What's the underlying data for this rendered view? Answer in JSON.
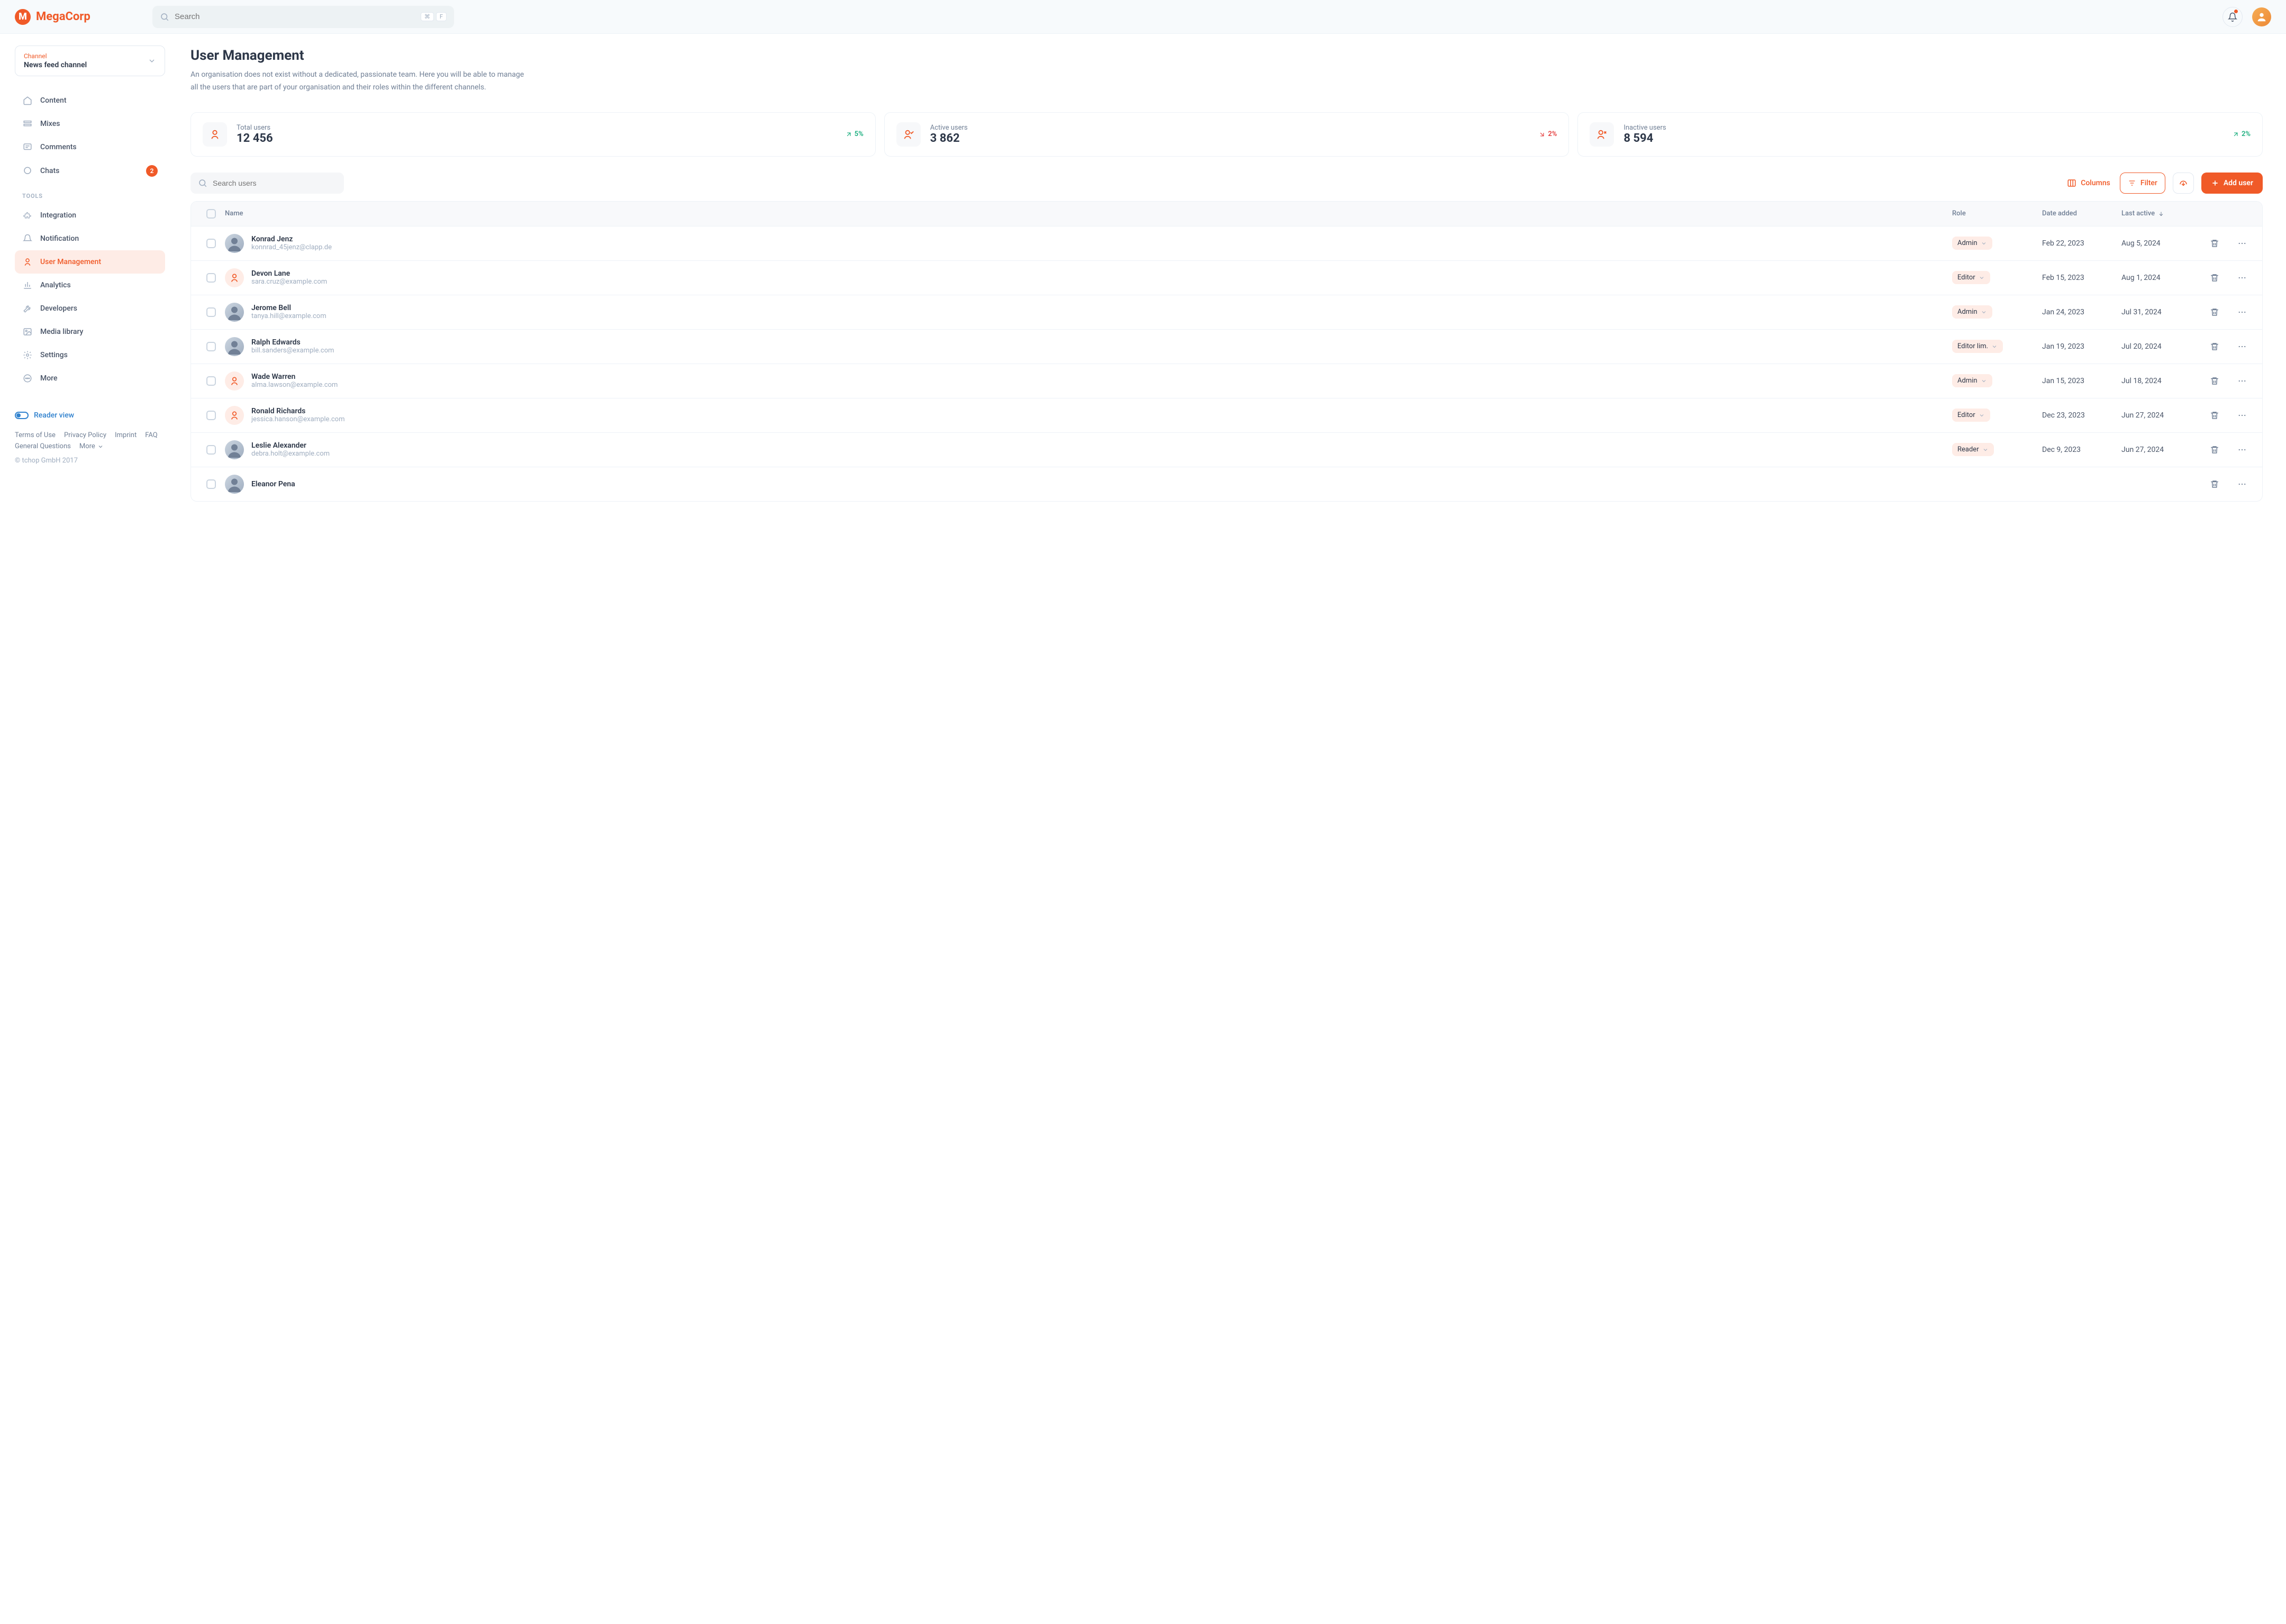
{
  "brand": {
    "name": "MegaCorp",
    "mark": "M"
  },
  "search": {
    "placeholder": "Search",
    "kbd1": "⌘",
    "kbd2": "F"
  },
  "channel": {
    "label": "Channel",
    "value": "News feed channel"
  },
  "nav": {
    "content": "Content",
    "mixes": "Mixes",
    "comments": "Comments",
    "chats": "Chats",
    "chats_badge": "2",
    "tools_label": "TOOLS",
    "integration": "Integration",
    "notification": "Notification",
    "user_management": "User Management",
    "analytics": "Analytics",
    "developers": "Developers",
    "media_library": "Media library",
    "settings": "Settings",
    "more": "More"
  },
  "reader_view": "Reader view",
  "footer": {
    "terms": "Terms of Use",
    "privacy": "Privacy Policy",
    "imprint": "Imprint",
    "faq": "FAQ",
    "general": "General Questions",
    "more": "More",
    "copyright": "© tchop GmbH 2017"
  },
  "page": {
    "title": "User Management",
    "description": "An organisation does not exist without a dedicated, passionate team. Here you will be able to manage all the users that are part of your organisation and their roles within the different channels."
  },
  "stats": [
    {
      "label": "Total users",
      "value": "12 456",
      "trend": "5%",
      "trend_dir": "up"
    },
    {
      "label": "Active users",
      "value": "3 862",
      "trend": "2%",
      "trend_dir": "down"
    },
    {
      "label": "Inactive users",
      "value": "8 594",
      "trend": "2%",
      "trend_dir": "up"
    }
  ],
  "toolbar": {
    "search_placeholder": "Search users",
    "columns": "Columns",
    "filter": "Filter",
    "add_user": "Add user"
  },
  "table": {
    "headers": {
      "name": "Name",
      "role": "Role",
      "date_added": "Date added",
      "last_active": "Last active"
    },
    "rows": [
      {
        "name": "Konrad Jenz",
        "email": "konnrad_45jenz@clapp.de",
        "role": "Admin",
        "date_added": "Feb 22, 2023",
        "last_active": "Aug 5, 2024",
        "avatar": "photo"
      },
      {
        "name": "Devon Lane",
        "email": "sara.cruz@example.com",
        "role": "Editor",
        "date_added": "Feb 15, 2023",
        "last_active": "Aug 1, 2024",
        "avatar": "icon"
      },
      {
        "name": "Jerome Bell",
        "email": "tanya.hill@example.com",
        "role": "Admin",
        "date_added": "Jan 24, 2023",
        "last_active": "Jul 31, 2024",
        "avatar": "photo"
      },
      {
        "name": "Ralph Edwards",
        "email": "bill.sanders@example.com",
        "role": "Editor lim.",
        "date_added": "Jan 19, 2023",
        "last_active": "Jul 20, 2024",
        "avatar": "photo"
      },
      {
        "name": "Wade Warren",
        "email": "alma.lawson@example.com",
        "role": "Admin",
        "date_added": "Jan 15, 2023",
        "last_active": "Jul 18, 2024",
        "avatar": "icon"
      },
      {
        "name": "Ronald Richards",
        "email": "jessica.hanson@example.com",
        "role": "Editor",
        "date_added": "Dec 23, 2023",
        "last_active": "Jun 27, 2024",
        "avatar": "icon"
      },
      {
        "name": "Leslie Alexander",
        "email": "debra.holt@example.com",
        "role": "Reader",
        "date_added": "Dec 9, 2023",
        "last_active": "Jun 27, 2024",
        "avatar": "photo"
      },
      {
        "name": "Eleanor Pena",
        "email": "",
        "role": "",
        "date_added": "",
        "last_active": "",
        "avatar": "photo"
      }
    ]
  }
}
